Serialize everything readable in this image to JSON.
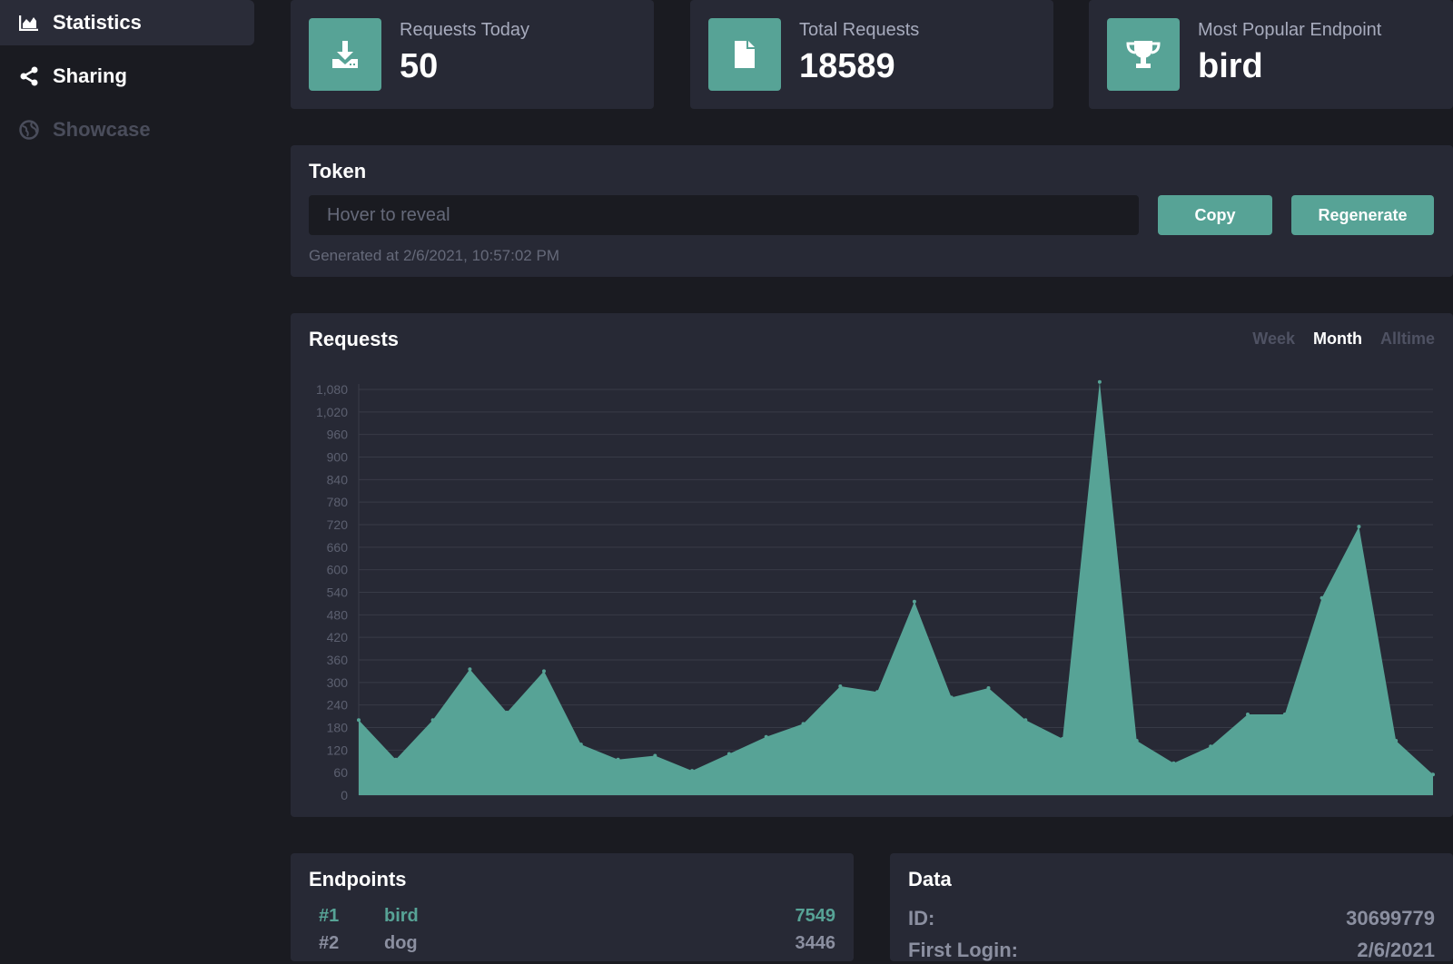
{
  "sidebar": {
    "items": [
      {
        "label": "Statistics",
        "icon": "area-chart-icon",
        "active": true
      },
      {
        "label": "Sharing",
        "icon": "share-icon",
        "active": false
      },
      {
        "label": "Showcase",
        "icon": "globe-icon",
        "active": false,
        "disabled": true
      }
    ]
  },
  "stats": [
    {
      "label": "Requests Today",
      "value": "50",
      "icon": "download-icon"
    },
    {
      "label": "Total Requests",
      "value": "18589",
      "icon": "file-icon"
    },
    {
      "label": "Most Popular Endpoint",
      "value": "bird",
      "icon": "trophy-icon"
    }
  ],
  "token": {
    "title": "Token",
    "placeholder": "Hover to reveal",
    "copy_label": "Copy",
    "regenerate_label": "Regenerate",
    "generated": "Generated at 2/6/2021, 10:57:02 PM"
  },
  "requests": {
    "title": "Requests",
    "ranges": [
      {
        "label": "Week",
        "active": false
      },
      {
        "label": "Month",
        "active": true
      },
      {
        "label": "Alltime",
        "active": false
      }
    ]
  },
  "chart_data": {
    "type": "area",
    "title": "Requests",
    "xlabel": "",
    "ylabel": "",
    "ylim": [
      0,
      1080
    ],
    "yticks": [
      "0",
      "60",
      "120",
      "180",
      "240",
      "300",
      "360",
      "420",
      "480",
      "540",
      "600",
      "660",
      "720",
      "780",
      "840",
      "900",
      "960",
      "1,020",
      "1,080"
    ],
    "grid": true,
    "color": "#57a396",
    "values": [
      200,
      95,
      200,
      335,
      220,
      330,
      135,
      95,
      105,
      65,
      110,
      155,
      190,
      290,
      275,
      515,
      260,
      285,
      200,
      150,
      1100,
      145,
      85,
      130,
      215,
      215,
      525,
      715,
      145,
      55
    ]
  },
  "endpoints": {
    "title": "Endpoints",
    "rows": [
      {
        "rank": "#1",
        "name": "bird",
        "count": "7549"
      },
      {
        "rank": "#2",
        "name": "dog",
        "count": "3446"
      }
    ]
  },
  "data_panel": {
    "title": "Data",
    "rows": [
      {
        "key": "ID:",
        "value": "30699779"
      },
      {
        "key": "First Login:",
        "value": "2/6/2021"
      }
    ]
  }
}
